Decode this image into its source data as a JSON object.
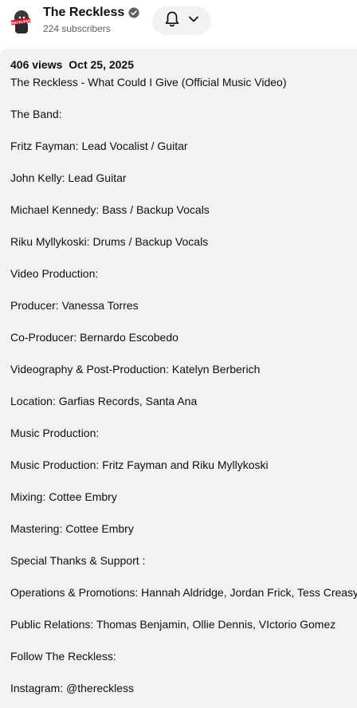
{
  "channel": {
    "name": "The Reckless",
    "subscribers": "224 subscribers",
    "avatar_label": "RECKLESS",
    "verified_icon": "verified-check-icon"
  },
  "subscribe_button": {
    "icons": [
      "bell-icon",
      "chevron-down-icon"
    ]
  },
  "description": {
    "views": "406 views",
    "date": "Oct 25, 2025",
    "lines": [
      "The Reckless - What Could I Give (Official Music Video)",
      "",
      "The Band:",
      "",
      "Fritz Fayman: Lead Vocalist / Guitar",
      "",
      "John Kelly: Lead Guitar",
      "",
      "Michael Kennedy: Bass / Backup Vocals",
      "",
      "Riku Myllykoski: Drums / Backup Vocals",
      "",
      "Video Production:",
      "",
      "Producer: Vanessa Torres",
      "",
      "Co-Producer: Bernardo Escobedo",
      "",
      "Videography & Post-Production: Katelyn Berberich",
      "",
      "Location: Garfias Records, Santa Ana",
      "",
      "Music Production:",
      "",
      "Music Production: Fritz Fayman and Riku Myllykoski",
      "",
      "Mixing: Cottee Embry",
      "",
      "Mastering: Cottee Embry",
      "",
      "Special Thanks & Support :",
      "",
      "Operations & Promotions: Hannah Aldridge, Jordan Frick, Tess Creasy",
      "",
      "Public Relations: Thomas Benjamin, Ollie Dennis, VIctorio Gomez",
      "",
      "Follow The Reckless:",
      "",
      "Instagram: @thereckless"
    ]
  },
  "colors": {
    "background": "#ffffff",
    "description_bg": "#f2f2f2",
    "text_primary": "#0f0f0f",
    "text_secondary": "#606060",
    "button_bg": "#f2f2f2"
  }
}
